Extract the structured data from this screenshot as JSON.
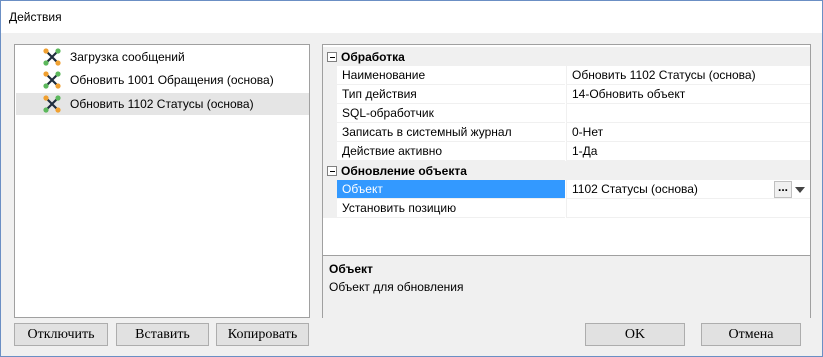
{
  "window": {
    "title": "Действия"
  },
  "tree": {
    "items": [
      {
        "label": "Загрузка сообщений",
        "icon": "action-tree-icon"
      },
      {
        "label": "Обновить 1001 Обращения (основа)",
        "icon": "action-tree-icon"
      },
      {
        "label": "Обновить 1102 Статусы (основа)",
        "icon": "action-tree-icon",
        "selected": true
      }
    ]
  },
  "grid": {
    "categories": [
      {
        "label": "Обработка",
        "properties": [
          {
            "name": "Наименование",
            "value": "Обновить 1102 Статусы (основа)"
          },
          {
            "name": "Тип действия",
            "value": "14-Обновить объект"
          },
          {
            "name": "SQL-обработчик",
            "value": ""
          },
          {
            "name": "Записать в системный журнал",
            "value": "0-Нет"
          },
          {
            "name": "Действие активно",
            "value": "1-Да"
          }
        ]
      },
      {
        "label": "Обновление объекта",
        "properties": [
          {
            "name": "Объект",
            "value": "1102 Статусы (основа)",
            "selected": true,
            "ellipsis": "..."
          },
          {
            "name": "Установить позицию",
            "value": ""
          }
        ]
      }
    ],
    "description": {
      "title": "Объект",
      "text": "Объект для обновления"
    }
  },
  "buttons": {
    "disable": "Отключить",
    "paste": "Вставить",
    "copy": "Копировать",
    "ok": "OK",
    "cancel": "Отмена"
  },
  "colors": {
    "selection": "#3399ff",
    "border": "#6b8fc4",
    "icon_green": "#5cb85c",
    "icon_orange": "#f0a030",
    "icon_dark": "#1f2d3d"
  }
}
